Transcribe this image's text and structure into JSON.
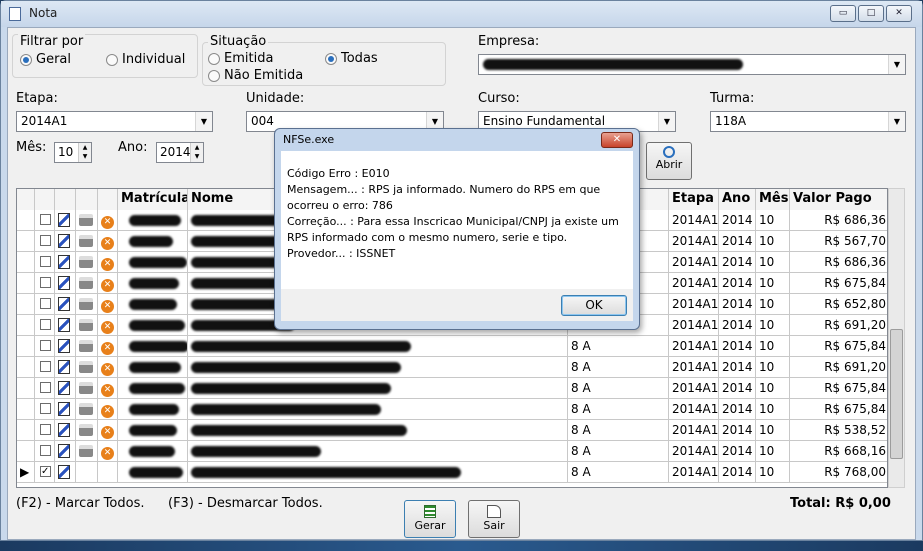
{
  "window": {
    "title": "Nota",
    "min": "▭",
    "max": "□",
    "close": "✕"
  },
  "filtrar": {
    "label": "Filtrar por",
    "geral": "Geral",
    "individual": "Individual"
  },
  "situacao": {
    "label": "Situação",
    "emitida": "Emitida",
    "nao_emitida": "Não Emitida",
    "todas": "Todas"
  },
  "empresa": {
    "label": "Empresa:"
  },
  "etapa": {
    "label": "Etapa:",
    "value": "2014A1"
  },
  "unidade": {
    "label": "Unidade:",
    "value": "004"
  },
  "curso": {
    "label": "Curso:",
    "value": "Ensino Fundamental"
  },
  "turma": {
    "label": "Turma:",
    "value": "118A"
  },
  "mes": {
    "label": "Mês:",
    "value": "10"
  },
  "ano": {
    "label": "Ano:",
    "value": "2014"
  },
  "abrir": {
    "label": "Abrir"
  },
  "columns": [
    "Matrícula",
    "Nome",
    "Etapa",
    "Ano",
    "Mês",
    "Valor Pago"
  ],
  "rows": [
    {
      "serie": "",
      "etapa": "2014A1",
      "ano": "2014",
      "mes": "10",
      "valor": "R$ 686,36",
      "checked": "",
      "sel": ""
    },
    {
      "serie": "",
      "etapa": "2014A1",
      "ano": "2014",
      "mes": "10",
      "valor": "R$ 567,70",
      "checked": "",
      "sel": ""
    },
    {
      "serie": "",
      "etapa": "2014A1",
      "ano": "2014",
      "mes": "10",
      "valor": "R$ 686,36",
      "checked": "",
      "sel": ""
    },
    {
      "serie": "",
      "etapa": "2014A1",
      "ano": "2014",
      "mes": "10",
      "valor": "R$ 675,84",
      "checked": "",
      "sel": ""
    },
    {
      "serie": "",
      "etapa": "2014A1",
      "ano": "2014",
      "mes": "10",
      "valor": "R$ 652,80",
      "checked": "",
      "sel": ""
    },
    {
      "serie": "",
      "etapa": "2014A1",
      "ano": "2014",
      "mes": "10",
      "valor": "R$ 691,20",
      "checked": "",
      "sel": ""
    },
    {
      "serie": "8 A",
      "etapa": "2014A1",
      "ano": "2014",
      "mes": "10",
      "valor": "R$ 675,84",
      "checked": "",
      "sel": ""
    },
    {
      "serie": "8 A",
      "etapa": "2014A1",
      "ano": "2014",
      "mes": "10",
      "valor": "R$ 691,20",
      "checked": "",
      "sel": ""
    },
    {
      "serie": "8 A",
      "etapa": "2014A1",
      "ano": "2014",
      "mes": "10",
      "valor": "R$ 675,84",
      "checked": "",
      "sel": ""
    },
    {
      "serie": "8 A",
      "etapa": "2014A1",
      "ano": "2014",
      "mes": "10",
      "valor": "R$ 675,84",
      "checked": "",
      "sel": ""
    },
    {
      "serie": "8 A",
      "etapa": "2014A1",
      "ano": "2014",
      "mes": "10",
      "valor": "R$ 538,52",
      "checked": "",
      "sel": ""
    },
    {
      "serie": "8 A",
      "etapa": "2014A1",
      "ano": "2014",
      "mes": "10",
      "valor": "R$ 668,16",
      "checked": "",
      "sel": ""
    },
    {
      "serie": "8 A",
      "etapa": "2014A1",
      "ano": "2014",
      "mes": "10",
      "valor": "R$ 768,00",
      "checked": "✓",
      "sel": "▶"
    }
  ],
  "footer": {
    "f2": "(F2) - Marcar Todos.",
    "f3": "(F3) - Desmarcar Todos.",
    "gerar": "Gerar",
    "sair": "Sair",
    "total": "Total: R$ 0,00"
  },
  "dialog": {
    "title": "NFSe.exe",
    "lines": [
      "Código Erro : E010",
      "Mensagem... : RPS ja informado. Numero do RPS em que",
      "ocorreu o erro: 786",
      "Correção... : Para essa Inscricao Municipal/CNPJ ja existe um",
      "RPS informado com o mesmo numero, serie e tipo.",
      "Provedor... : ISSNET"
    ],
    "ok": "OK"
  }
}
